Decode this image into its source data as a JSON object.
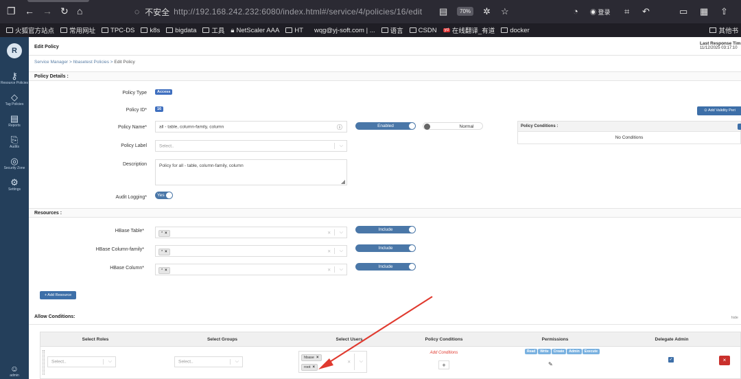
{
  "browser": {
    "url_insecure": "不安全",
    "url": "http://192.168.242.232:6080/index.html#/service/4/policies/16/edit",
    "zoom": "70%",
    "account_label": "登录",
    "bookmarks": [
      "火狐官方站点",
      "常用网址",
      "TPC-DS",
      "k8s",
      "bigdata",
      "工具",
      "NetScaler AAA",
      "HT",
      "wqg@yj-soft.com | ...",
      "语言",
      "CSDN",
      "在线翻译_有道",
      "docker"
    ],
    "bookmarks_other": "其他书"
  },
  "sidebar": {
    "items": [
      {
        "label": "Resource Policies",
        "icon": "key-icon"
      },
      {
        "label": "Tag Policies",
        "icon": "tag-icon"
      },
      {
        "label": "Reports",
        "icon": "report-icon"
      },
      {
        "label": "Audits",
        "icon": "audit-icon"
      },
      {
        "label": "Security Zone",
        "icon": "zone-icon"
      },
      {
        "label": "Settings",
        "icon": "gear-icon"
      }
    ],
    "user": "admin"
  },
  "header": {
    "title": "Edit Policy",
    "last_response_label": "Last Response Tim",
    "last_response_value": "11/12/2025 03:17:10"
  },
  "breadcrumb": {
    "items": [
      "Service Manager",
      "hbasetest Policies",
      "Edit Policy"
    ],
    "sep": ">"
  },
  "policy_details": {
    "section_title": "Policy Details :",
    "type_label": "Policy Type",
    "type_value": "Access",
    "id_label": "Policy ID*",
    "id_value": "16",
    "name_label": "Policy Name*",
    "name_value": "all - table, column-family, column",
    "enabled_label": "Enabled",
    "priority_label": "Normal",
    "label_label": "Policy Label",
    "label_placeholder": "Select..",
    "desc_label": "Description",
    "desc_value": "Policy for all - table, column-family, column",
    "audit_label": "Audit Logging*",
    "audit_value": "Yes",
    "validity_button": "Add Validity Peri",
    "conditions_title": "Policy Conditions :",
    "conditions_empty": "No Conditions"
  },
  "resources": {
    "section_title": "Resources :",
    "rows": [
      {
        "label": "HBase Table*",
        "value": "*",
        "toggle": "Include"
      },
      {
        "label": "HBase Column-family*",
        "value": "*",
        "toggle": "Include"
      },
      {
        "label": "HBase Column*",
        "value": "*",
        "toggle": "Include"
      }
    ],
    "add_button": "Add Resource"
  },
  "allow": {
    "section_title": "Allow Conditions:",
    "hide_label": "hide",
    "columns": [
      "Select Roles",
      "Select Groups",
      "Select Users",
      "Policy Conditions",
      "Permissions",
      "Delegate Admin"
    ],
    "roles_placeholder": "Select..",
    "groups_placeholder": "Select..",
    "users": [
      "hbase",
      "root"
    ],
    "add_conditions": "Add Conditions",
    "permissions": [
      "Read",
      "Write",
      "Create",
      "Admin",
      "Execute"
    ]
  },
  "colors": {
    "sidebar": "#243f5b",
    "accent": "#3d6fa8",
    "arrow": "#e03a2f"
  }
}
